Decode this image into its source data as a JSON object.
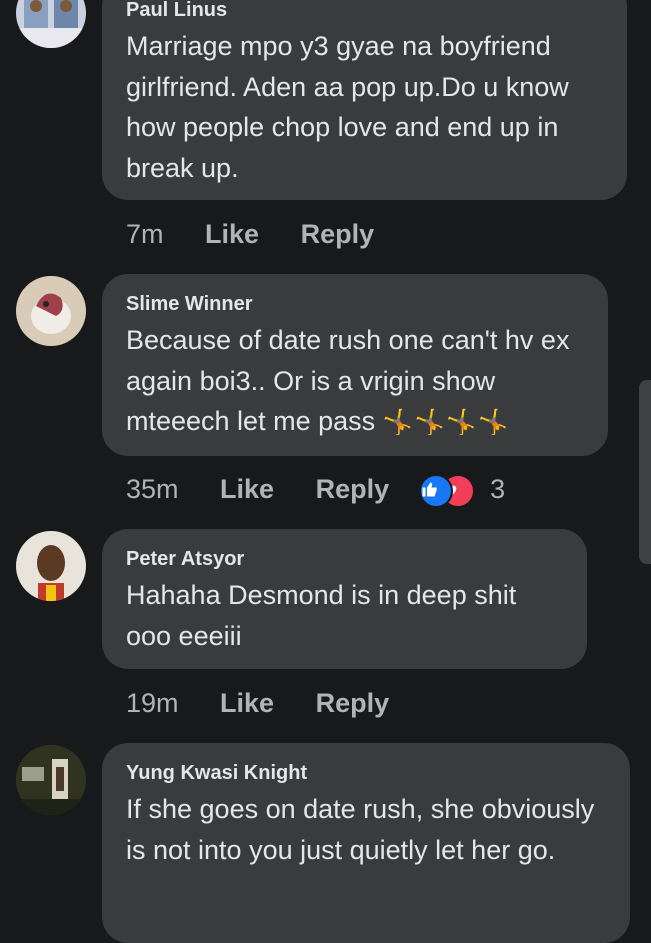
{
  "comments": [
    {
      "author": "Paul Linus",
      "text": "Marriage mpo y3 gyae na boyfriend girlfriend. Aden aa pop up.Do u know how people chop love and end up in break up.",
      "time": "7m",
      "like_label": "Like",
      "reply_label": "Reply"
    },
    {
      "author": "Slime Winner",
      "text": "Because of date rush one can't hv ex again boi3.. Or is a vrigin show mteeech let me pass",
      "emoji": "🤸🤸🤸🤸",
      "time": "35m",
      "like_label": "Like",
      "reply_label": "Reply",
      "reaction_count": "3",
      "reaction_icons": [
        "like-icon",
        "love-icon"
      ]
    },
    {
      "author": "Peter Atsyor",
      "text": "Hahaha Desmond is in deep shit ooo eeeiii",
      "time": "19m",
      "like_label": "Like",
      "reply_label": "Reply"
    },
    {
      "author": "Yung Kwasi Knight",
      "text": "If she goes on date rush, she obviously is not into you just quietly let her go."
    }
  ],
  "colors": {
    "background": "#18191a",
    "bubble": "#3a3b3c",
    "text": "#e4e6eb",
    "secondary": "#b0b3b8",
    "like_blue": "#1877f2",
    "love_red": "#f33e58"
  }
}
